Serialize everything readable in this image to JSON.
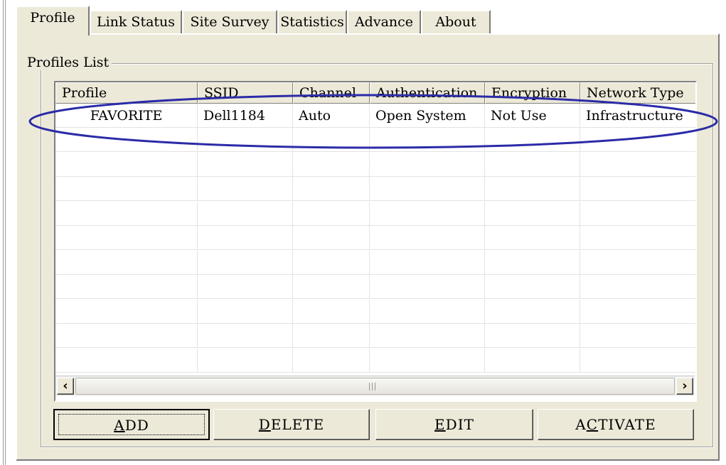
{
  "tabs": [
    {
      "label": "Profile",
      "active": true
    },
    {
      "label": "Link Status",
      "active": false
    },
    {
      "label": "Site Survey",
      "active": false
    },
    {
      "label": "Statistics",
      "active": false
    },
    {
      "label": "Advance",
      "active": false
    },
    {
      "label": "About",
      "active": false
    }
  ],
  "profiles_list": {
    "title": "Profiles List",
    "columns": [
      "Profile",
      "SSID",
      "Channel",
      "Authentication",
      "Encryption",
      "Network Type"
    ],
    "rows": [
      [
        "FAVORITE",
        "Dell1184",
        "Auto",
        "Open System",
        "Not Use",
        "Infrastructure"
      ]
    ],
    "empty_row_count": 10
  },
  "scrollbar": {
    "left_icon": "arrow-left-icon",
    "right_icon": "arrow-right-icon"
  },
  "buttons": {
    "add": {
      "label": "ADD",
      "accel": "A"
    },
    "delete": {
      "label": "DELETE",
      "accel": "D"
    },
    "edit": {
      "label": "EDIT",
      "accel": "E"
    },
    "activate": {
      "label": "ACTIVATE",
      "accel": "C"
    }
  },
  "annotation": {
    "shape": "ellipse",
    "color": "#2b2ba8"
  }
}
